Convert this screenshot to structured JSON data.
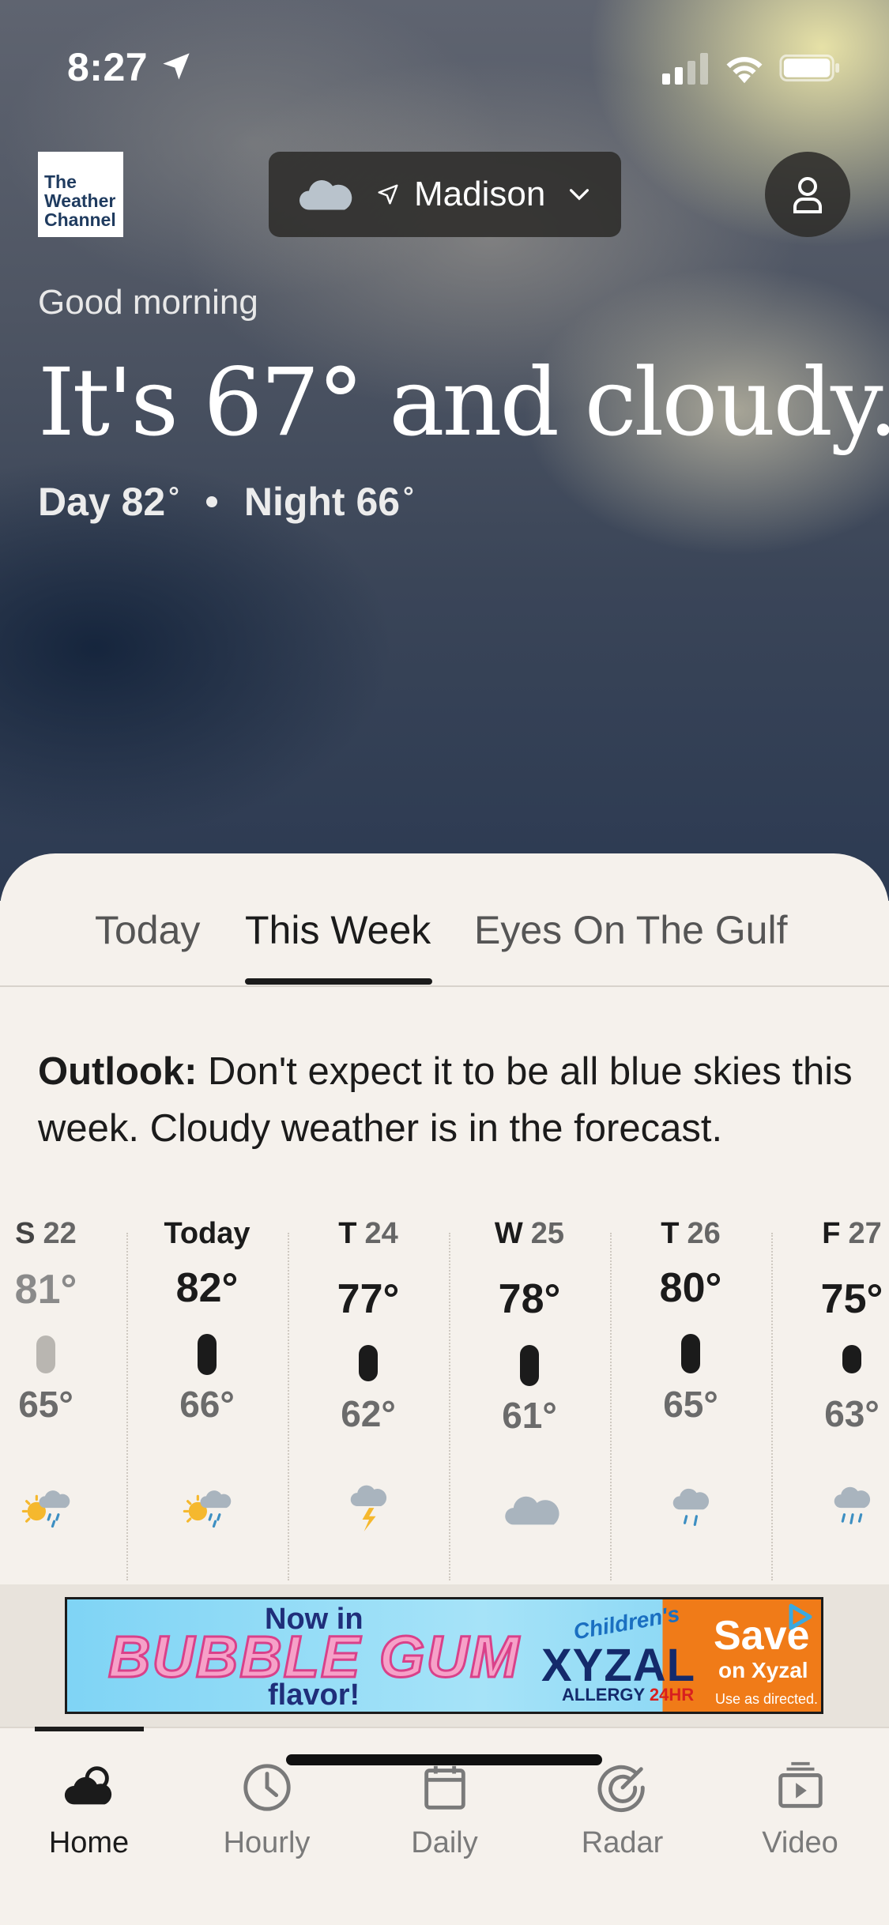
{
  "status_bar": {
    "time": "8:27"
  },
  "header": {
    "logo_lines": [
      "The",
      "Weather",
      "Channel"
    ],
    "location": "Madison"
  },
  "hero": {
    "greeting": "Good morning",
    "headline": "It's 67° and cloudy.",
    "day": "Day 82",
    "night": "Night 66",
    "degree": "°"
  },
  "tabs": [
    "Today",
    "This Week",
    "Eyes On The Gulf"
  ],
  "outlook": {
    "label": "Outlook:",
    "text": " Don't expect it to be all blue skies this week. Cloudy weather is in the forecast."
  },
  "forecast": [
    {
      "day": "S",
      "date": "22",
      "high": "81°",
      "low": "65°",
      "icon": "sun-cloud-rain-icon",
      "past": true
    },
    {
      "day": "Today",
      "date": "",
      "high": "82°",
      "low": "66°",
      "icon": "sun-cloud-rain-icon",
      "past": false
    },
    {
      "day": "T",
      "date": "24",
      "high": "77°",
      "low": "62°",
      "icon": "thunderstorm-icon",
      "past": false
    },
    {
      "day": "W",
      "date": "25",
      "high": "78°",
      "low": "61°",
      "icon": "cloudy-icon",
      "past": false
    },
    {
      "day": "T",
      "date": "26",
      "high": "80°",
      "low": "65°",
      "icon": "light-rain-icon",
      "past": false
    },
    {
      "day": "F",
      "date": "27",
      "high": "75°",
      "low": "63°",
      "icon": "rain-icon",
      "past": false
    }
  ],
  "ad": {
    "line1": "Now in",
    "line2": "BUBBLE GUM",
    "line3": "flavor!",
    "brand_small": "Children's",
    "brand": "XYZAL",
    "allergy": "ALLERGY",
    "allergy_hr": "24HR",
    "cta": "Save",
    "cta2": "on Xyzal",
    "disclaimer": "Use as directed."
  },
  "bottom_nav": [
    {
      "label": "Home",
      "icon": "home-weather-icon",
      "active": true
    },
    {
      "label": "Hourly",
      "icon": "clock-icon",
      "active": false
    },
    {
      "label": "Daily",
      "icon": "calendar-icon",
      "active": false
    },
    {
      "label": "Radar",
      "icon": "radar-icon",
      "active": false
    },
    {
      "label": "Video",
      "icon": "video-icon",
      "active": false
    }
  ],
  "colors": {
    "accent": "#1b1b1b",
    "sheet_bg": "#f5f1ec",
    "pill_bg": "#2d2c2a"
  }
}
